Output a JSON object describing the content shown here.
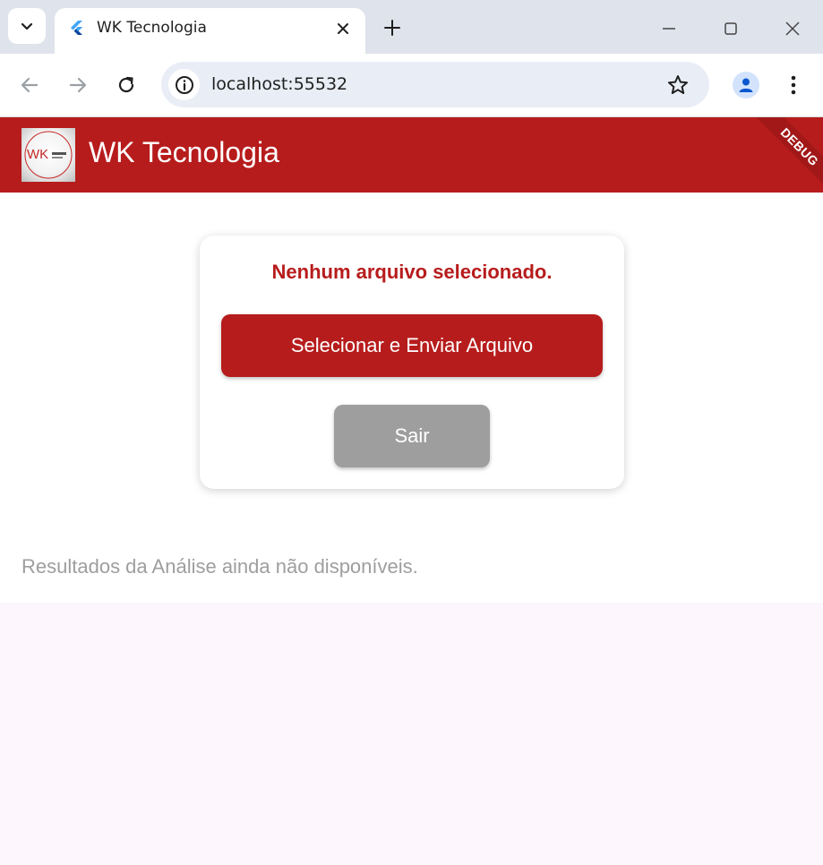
{
  "browser": {
    "tab_title": "WK Tecnologia",
    "url": "localhost:55532"
  },
  "appbar": {
    "title": "WK Tecnologia",
    "logo_text": "WK",
    "debug_label": "DEBUG"
  },
  "card": {
    "status_text": "Nenhum arquivo selecionado.",
    "select_button_label": "Selecionar e Enviar Arquivo",
    "exit_button_label": "Sair"
  },
  "results_text": "Resultados da Análise ainda não disponíveis.",
  "colors": {
    "primary": "#b71c1c",
    "secondary": "#9e9e9e",
    "background": "#fdf6fc"
  }
}
